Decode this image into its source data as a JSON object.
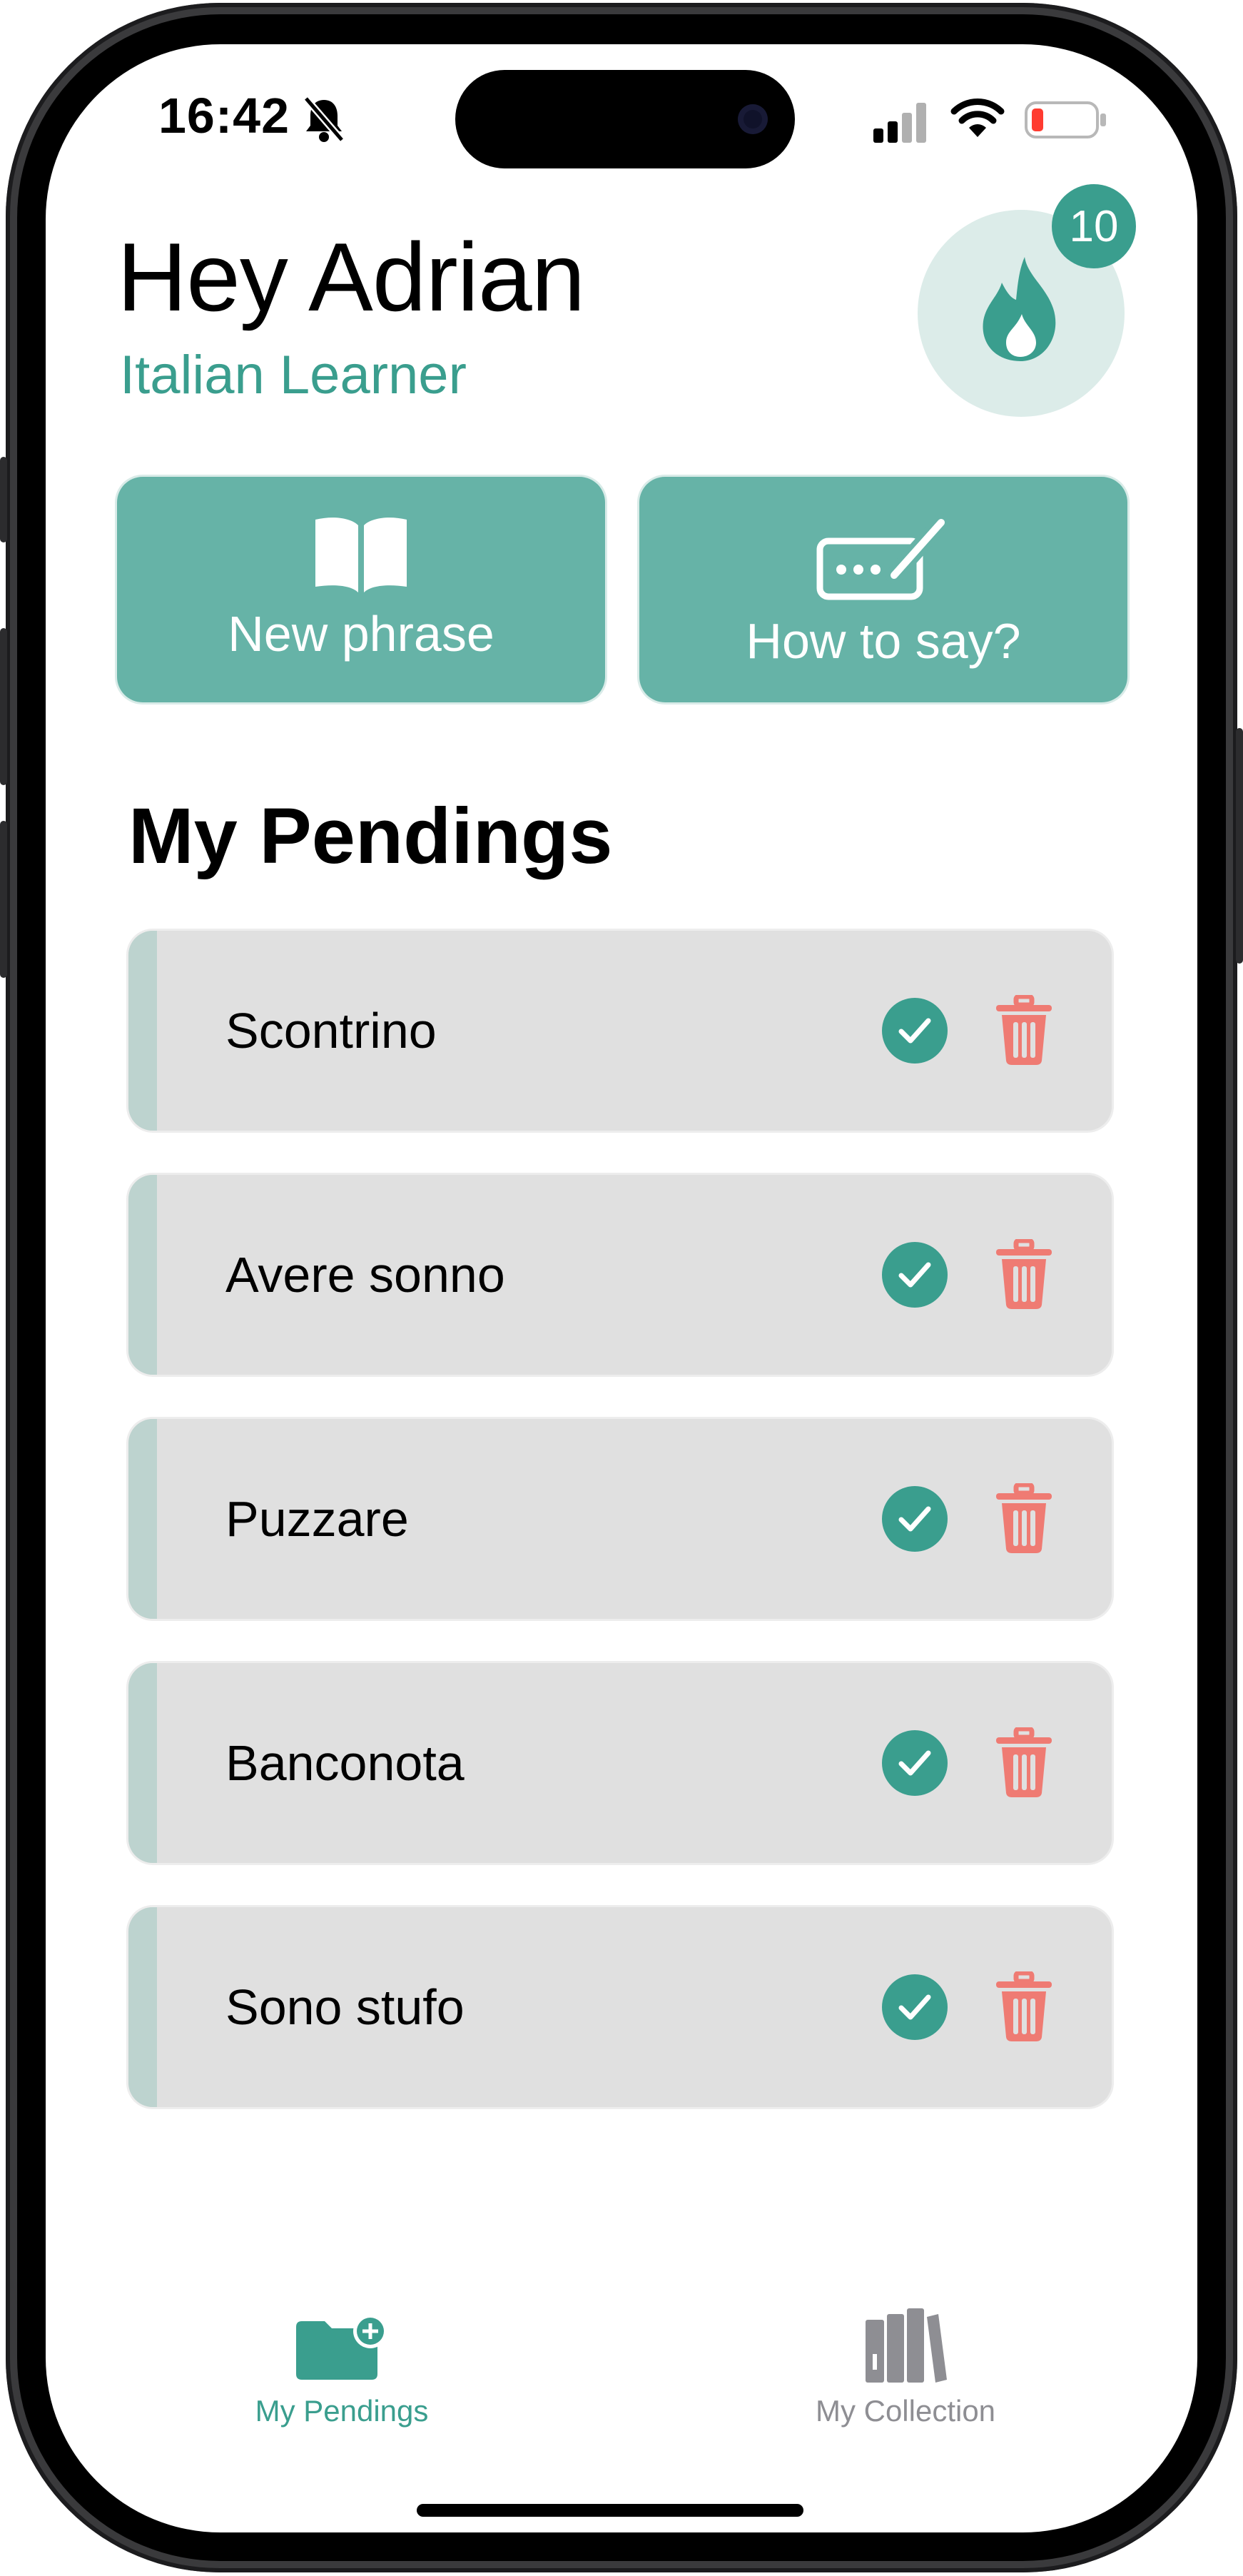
{
  "status_bar": {
    "time": "16:42",
    "icons": [
      "bell-slash-icon",
      "cellular-signal-icon",
      "wifi-icon",
      "battery-icon"
    ]
  },
  "header": {
    "greeting": "Hey Adrian",
    "subtitle": "Italian Learner",
    "streak_count": "10",
    "streak_icon": "flame-icon"
  },
  "actions": {
    "new_phrase": {
      "label": "New phrase",
      "icon": "open-book-icon"
    },
    "how_to_say": {
      "label": "How to say?",
      "icon": "keyboard-pen-icon"
    }
  },
  "pendings": {
    "title": "My Pendings",
    "items": [
      {
        "phrase": "Scontrino"
      },
      {
        "phrase": "Avere sonno"
      },
      {
        "phrase": "Puzzare"
      },
      {
        "phrase": "Banconota"
      },
      {
        "phrase": "Sono stufo"
      }
    ]
  },
  "tab_bar": {
    "tabs": [
      {
        "label": "My Pendings",
        "icon": "folder-plus-icon",
        "active": true
      },
      {
        "label": "My Collection",
        "icon": "books-icon",
        "active": false
      }
    ]
  },
  "colors": {
    "accent": "#3a9e8e",
    "button": "#66b3a7",
    "row_bg": "#e0e0e0",
    "delete": "#ef7b73",
    "inactive_tab": "#8e8e93"
  }
}
